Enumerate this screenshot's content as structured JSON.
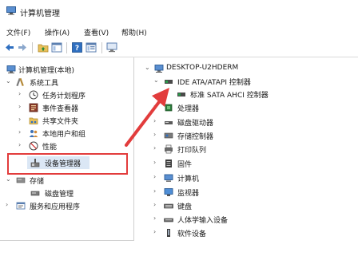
{
  "window": {
    "title": "计算机管理"
  },
  "menu": {
    "items": [
      "文件(F)",
      "操作(A)",
      "查看(V)",
      "帮助(H)"
    ]
  },
  "toolbar": {
    "icons": [
      "back-icon",
      "forward-icon",
      "folder-up-icon",
      "show-pane-icon",
      "help-icon",
      "properties-icon",
      "console-icon"
    ]
  },
  "left_tree": {
    "root": "计算机管理(本地)",
    "system_tools": "系统工具",
    "task_scheduler": "任务计划程序",
    "event_viewer": "事件查看器",
    "shared_folders": "共享文件夹",
    "local_users": "本地用户和组",
    "performance": "性能",
    "device_manager": "设备管理器",
    "storage": "存储",
    "disk_management": "磁盘管理",
    "services_apps": "服务和应用程序"
  },
  "right_tree": {
    "computer": "DESKTOP-U2HDERM",
    "ide_controller": "IDE ATA/ATAPI 控制器",
    "ahci": "标准 SATA AHCI 控制器",
    "processors": "处理器",
    "disk_drives": "磁盘驱动器",
    "storage_controllers": "存储控制器",
    "print_queues": "打印队列",
    "firmware": "固件",
    "computer_node": "计算机",
    "monitors": "监视器",
    "keyboards": "键盘",
    "hid": "人体学输入设备",
    "software_devices": "软件设备"
  },
  "colors": {
    "highlight_box": "#e23c3c",
    "arrow": "#e23c3c",
    "selection": "#dbe7f5"
  }
}
